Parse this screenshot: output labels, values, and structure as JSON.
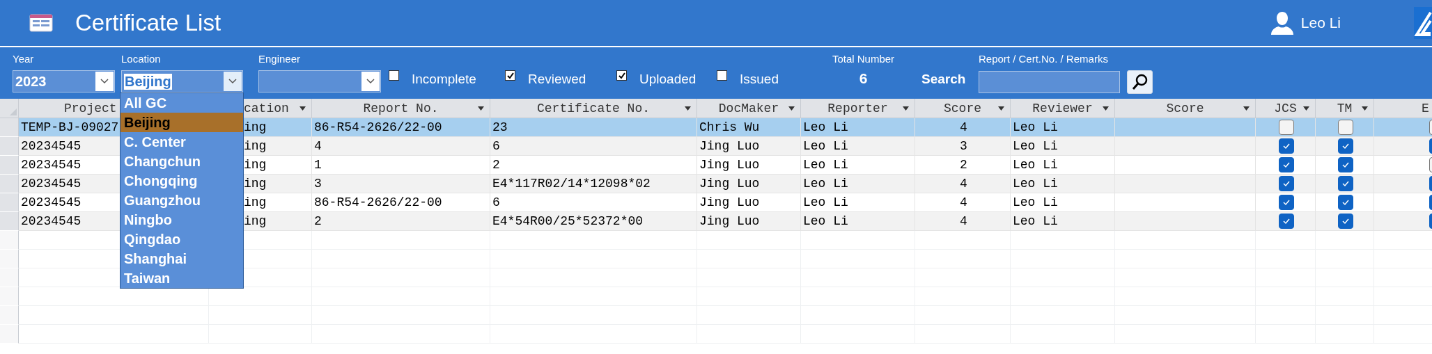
{
  "header": {
    "title": "Certificate List",
    "user": "Leo Li"
  },
  "filters": {
    "year": {
      "label": "Year",
      "value": "2023"
    },
    "location": {
      "label": "Location",
      "value": "Beijing",
      "expanded": true
    },
    "engineer": {
      "label": "Engineer"
    },
    "checkboxes": [
      {
        "label": "Incomplete",
        "checked": false
      },
      {
        "label": "Reviewed",
        "checked": true
      },
      {
        "label": "Uploaded",
        "checked": true
      },
      {
        "label": "Issued",
        "checked": false
      }
    ],
    "total": {
      "label": "Total Number",
      "value": "6"
    },
    "search": {
      "label": "Search",
      "field_label": "Report / Cert.No. / Remarks"
    }
  },
  "location_dropdown": {
    "items": [
      {
        "label": "All GC",
        "selected": false
      },
      {
        "label": "Beijing",
        "selected": true
      },
      {
        "label": "C. Center",
        "selected": false
      },
      {
        "label": "Changchun",
        "selected": false
      },
      {
        "label": "Chongqing",
        "selected": false
      },
      {
        "label": "Guangzhou",
        "selected": false
      },
      {
        "label": "Ningbo",
        "selected": false
      },
      {
        "label": "Qingdao",
        "selected": false
      },
      {
        "label": "Shanghai",
        "selected": false
      },
      {
        "label": "Taiwan",
        "selected": false
      }
    ]
  },
  "table": {
    "columns": [
      {
        "label": "Project",
        "kind": "project"
      },
      {
        "label": "cation",
        "kind": "location"
      },
      {
        "label": "Report No.",
        "kind": "text"
      },
      {
        "label": "Certificate No.",
        "kind": "text"
      },
      {
        "label": "DocMaker",
        "kind": "text"
      },
      {
        "label": "Reporter",
        "kind": "text"
      },
      {
        "label": "Score",
        "kind": "num"
      },
      {
        "label": "Reviewer",
        "kind": "text"
      },
      {
        "label": "Score",
        "kind": "num"
      },
      {
        "label": "JCS",
        "kind": "check"
      },
      {
        "label": "TM",
        "kind": "check"
      },
      {
        "label": "E",
        "kind": "edge"
      }
    ],
    "rows": [
      {
        "selected": true,
        "project": "TEMP-BJ-09027",
        "location": "ing",
        "report_no": "86-R54-2626/22-00",
        "certificate_no": "23",
        "docmaker": "Chris Wu",
        "reporter": "Leo Li",
        "score": "4",
        "reviewer": "Leo Li",
        "jcs": false,
        "tm": false,
        "ec": false
      },
      {
        "selected": false,
        "project": "20234545",
        "location": "ing",
        "report_no": "4",
        "certificate_no": "6",
        "docmaker": "Jing Luo",
        "reporter": "Leo Li",
        "score": "3",
        "reviewer": "Leo Li",
        "jcs": true,
        "tm": true,
        "ec": true
      },
      {
        "selected": false,
        "project": "20234545",
        "location": "ing",
        "report_no": "1",
        "certificate_no": "2",
        "docmaker": "Jing Luo",
        "reporter": "Leo Li",
        "score": "2",
        "reviewer": "Leo Li",
        "jcs": true,
        "tm": true,
        "ec": false
      },
      {
        "selected": false,
        "project": "20234545",
        "location": "ing",
        "report_no": "3",
        "certificate_no": "E4*117R02/14*12098*02",
        "docmaker": "Jing Luo",
        "reporter": "Leo Li",
        "score": "4",
        "reviewer": "Leo Li",
        "jcs": true,
        "tm": true,
        "ec": true
      },
      {
        "selected": false,
        "project": "20234545",
        "location": "ing",
        "report_no": "86-R54-2626/22-00",
        "certificate_no": "6",
        "docmaker": "Jing Luo",
        "reporter": "Leo Li",
        "score": "4",
        "reviewer": "Leo Li",
        "jcs": true,
        "tm": true,
        "ec": true
      },
      {
        "selected": false,
        "project": "20234545",
        "location": "ing",
        "report_no": "2",
        "certificate_no": "E4*54R00/25*52372*00",
        "docmaker": "Jing Luo",
        "reporter": "Leo Li",
        "score": "4",
        "reviewer": "Leo Li",
        "jcs": true,
        "tm": true,
        "ec": true
      }
    ]
  }
}
